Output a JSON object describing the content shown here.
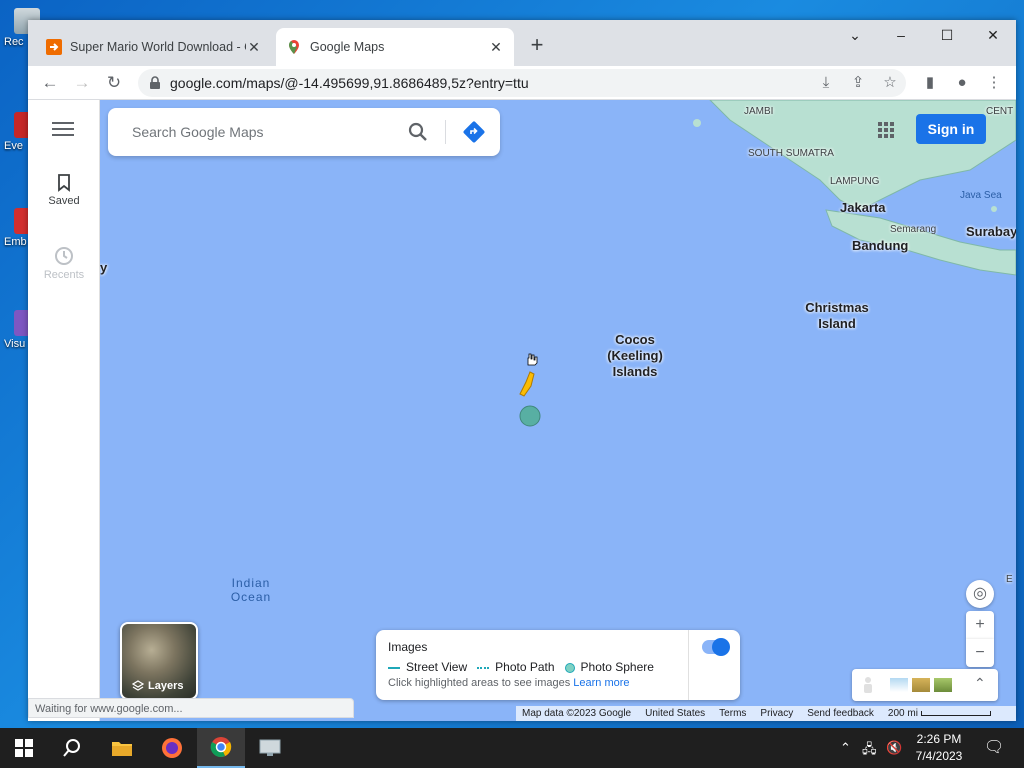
{
  "desktop": {
    "icons": [
      {
        "label": "Rec"
      },
      {
        "label": "Eve"
      },
      {
        "label": "Emb De"
      },
      {
        "label": "Visu"
      }
    ]
  },
  "browser": {
    "tabs": [
      {
        "title": "Super Mario World Download - C",
        "active": false
      },
      {
        "title": "Google Maps",
        "active": true
      }
    ],
    "url": "google.com/maps/@-14.495699,91.8686489,5z?entry=ttu",
    "status": "Waiting for www.google.com..."
  },
  "maps": {
    "rail": {
      "saved": "Saved",
      "recents": "Recents"
    },
    "search_placeholder": "Search Google Maps",
    "sign_in": "Sign in",
    "places": {
      "jambi": "JAMBI",
      "south_sumatra": "SOUTH SUMATRA",
      "lampung": "LAMPUNG",
      "jakarta": "Jakarta",
      "semarang": "Semarang",
      "bandung": "Bandung",
      "surabaya": "Surabay",
      "java_sea": "Java Sea",
      "centr": "CENT",
      "christmas": "Christmas Island",
      "cocos": "Cocos (Keeling) Islands",
      "indian_ocean": "Indian Ocean",
      "edge_y": "y",
      "edge_e": "E"
    },
    "layers": "Layers",
    "images_card": {
      "title": "Images",
      "street_view": "Street View",
      "photo_path": "Photo Path",
      "photo_sphere": "Photo Sphere",
      "hint": "Click highlighted areas to see images",
      "learn_more": "Learn more"
    },
    "attribution": {
      "data": "Map data ©2023 Google",
      "country": "United States",
      "terms": "Terms",
      "privacy": "Privacy",
      "feedback": "Send feedback",
      "scale": "200 mi"
    }
  },
  "taskbar": {
    "time": "2:26 PM",
    "date": "7/4/2023"
  },
  "colors": {
    "water": "#8ab4f8",
    "land": "#b8e0d2",
    "accent": "#1a73e8"
  }
}
